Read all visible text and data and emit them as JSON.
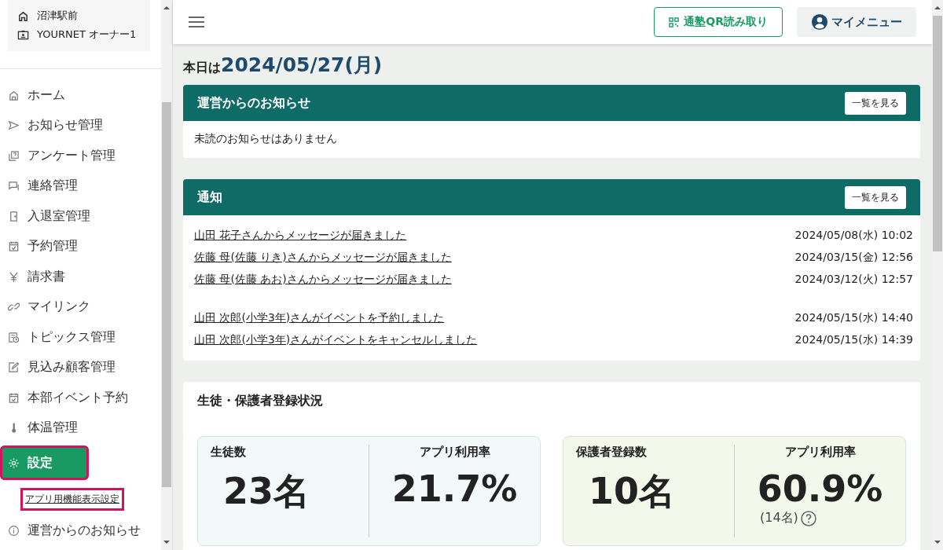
{
  "account": {
    "school": "沼津駅前",
    "user": "YOURNET オーナー1"
  },
  "sidebar": {
    "items": [
      {
        "label": "ホーム",
        "selected": false,
        "highlighted": false
      },
      {
        "label": "お知らせ管理",
        "selected": false,
        "highlighted": false
      },
      {
        "label": "アンケート管理",
        "selected": false,
        "highlighted": false
      },
      {
        "label": "連絡管理",
        "selected": false,
        "highlighted": false
      },
      {
        "label": "入退室管理",
        "selected": false,
        "highlighted": false
      },
      {
        "label": "予約管理",
        "selected": false,
        "highlighted": false
      },
      {
        "label": "請求書",
        "selected": false,
        "highlighted": false
      },
      {
        "label": "マイリンク",
        "selected": false,
        "highlighted": false
      },
      {
        "label": "トピックス管理",
        "selected": false,
        "highlighted": false
      },
      {
        "label": "見込み顧客管理",
        "selected": false,
        "highlighted": false
      },
      {
        "label": "本部イベント予約",
        "selected": false,
        "highlighted": false
      },
      {
        "label": "体温管理",
        "selected": false,
        "highlighted": false
      },
      {
        "label": "設定",
        "selected": true,
        "highlighted": true,
        "children": [
          {
            "label": "アプリ用機能表示設定",
            "highlighted": true
          }
        ]
      },
      {
        "label": "運営からのお知らせ",
        "selected": false,
        "highlighted": false
      }
    ]
  },
  "header": {
    "qr_button": "通塾QR読み取り",
    "menu_button": "マイメニュー"
  },
  "today": {
    "prefix": "本日は",
    "date": "2024/05/27(月)"
  },
  "announcements": {
    "title": "運営からのお知らせ",
    "more": "一覧を見る",
    "empty": "未読のお知らせはありません"
  },
  "notifications": {
    "title": "通知",
    "more": "一覧を見る",
    "groups": [
      {
        "items": [
          {
            "text": "山田 花子さんからメッセージが届きました",
            "time": "2024/05/08(水) 10:02"
          },
          {
            "text": "佐藤 母(佐藤 りき)さんからメッセージが届きました",
            "time": "2024/03/15(金) 12:56"
          },
          {
            "text": "佐藤 母(佐藤 あお)さんからメッセージが届きました",
            "time": "2024/03/12(火) 12:57"
          }
        ]
      },
      {
        "items": [
          {
            "text": "山田 次郎(小学3年)さんがイベントを予約しました",
            "time": "2024/05/15(水) 14:40"
          },
          {
            "text": "山田 次郎(小学3年)さんがイベントをキャンセルしました",
            "time": "2024/05/15(水) 14:39"
          }
        ]
      }
    ]
  },
  "registration": {
    "title": "生徒・保護者登録状況",
    "cards": [
      {
        "color": "#f3f8f8",
        "count_label": "生徒数",
        "count": "23名",
        "rate_label": "アプリ利用率",
        "rate": "21.7%"
      },
      {
        "color": "#f4f8ea",
        "count_label": "保護者登録数",
        "count": "10名",
        "rate_label": "アプリ利用率",
        "rate": "60.9%",
        "note": "(14名)"
      }
    ]
  }
}
